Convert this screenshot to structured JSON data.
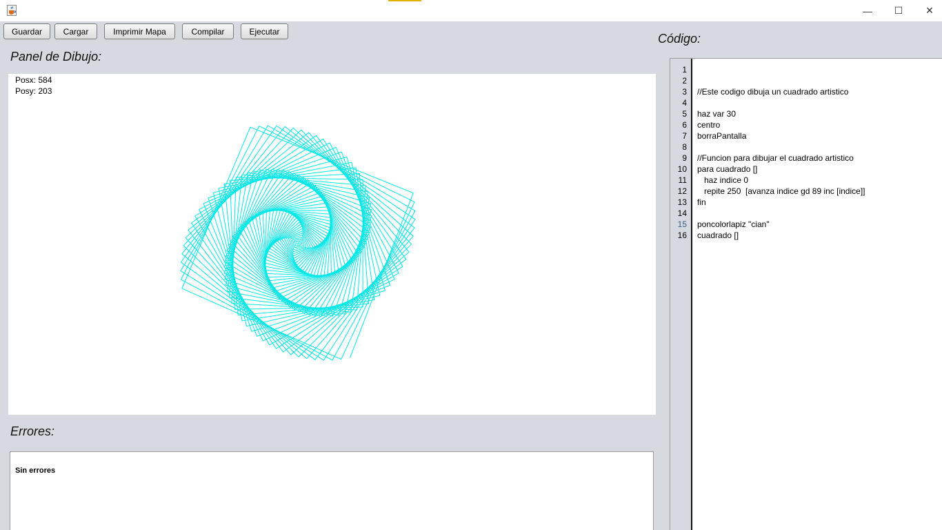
{
  "window": {
    "title": "",
    "icon": "java-cup-icon",
    "controls": {
      "minimize": "—",
      "maximize": "☐",
      "close": "✕"
    }
  },
  "toolbar": {
    "guardar": "Guardar",
    "cargar": "Cargar",
    "imprimir": "Imprimir Mapa",
    "compilar": "Compilar",
    "ejecutar": "Ejecutar"
  },
  "drawing": {
    "title": "Panel de Dibujo:",
    "posx_label": "Posx: 584",
    "posy_label": "Posy: 203",
    "pen_color": "#00e8e8",
    "background": "#ffffff"
  },
  "errors": {
    "title": "Errores:",
    "message": "Sin errores"
  },
  "code": {
    "title": "Código:",
    "line_numbers": [
      "1",
      "2",
      "3",
      "4",
      "5",
      "6",
      "7",
      "8",
      "9",
      "10",
      "11",
      "12",
      "13",
      "14",
      "15",
      "16"
    ],
    "lines": [
      "",
      "",
      "//Este codigo dibuja un cuadrado artistico",
      "",
      "haz var 30",
      "centro",
      "borraPantalla",
      "",
      "//Funcion para dibujar el cuadrado artistico",
      "para cuadrado []",
      "   haz indice 0",
      "   repite 250  [avanza indice gd 89 inc [indice]]",
      "fin",
      "",
      "poncolorlapiz \"cian\"",
      "cuadrado []"
    ]
  }
}
